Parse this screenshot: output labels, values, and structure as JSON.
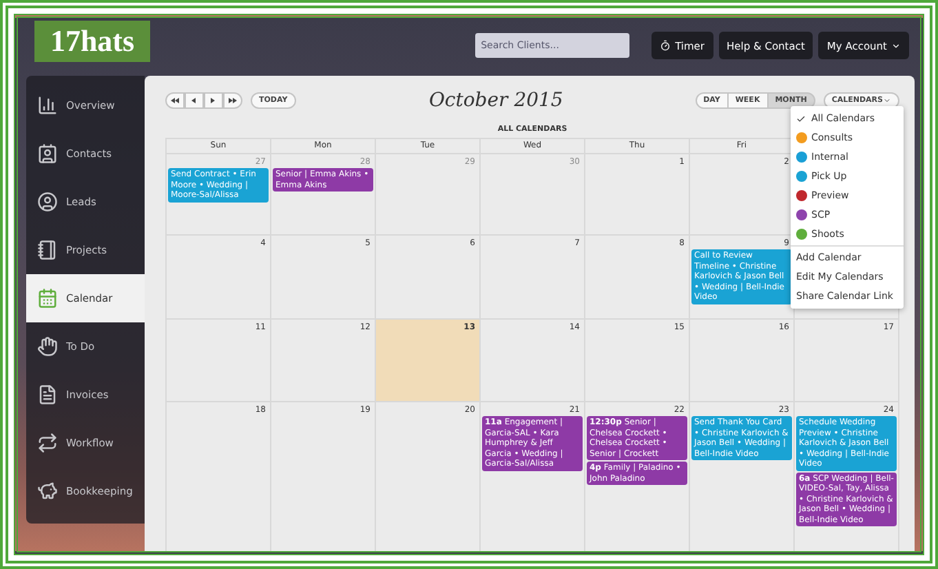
{
  "logo": "17hats",
  "header": {
    "search": {
      "placeholder": "Search Clients..."
    },
    "timer": "Timer",
    "help": "Help & Contact",
    "account": "My Account"
  },
  "sidebar": {
    "items": [
      {
        "label": "Overview",
        "selected": false
      },
      {
        "label": "Contacts",
        "selected": false
      },
      {
        "label": "Leads",
        "selected": false
      },
      {
        "label": "Projects",
        "selected": false
      },
      {
        "label": "Calendar",
        "selected": true
      },
      {
        "label": "To Do",
        "selected": false
      },
      {
        "label": "Invoices",
        "selected": false
      },
      {
        "label": "Workflow",
        "selected": false
      },
      {
        "label": "Bookkeeping",
        "selected": false
      }
    ]
  },
  "toolbar": {
    "today": "TODAY",
    "title": "October 2015",
    "views": [
      {
        "label": "DAY",
        "selected": false
      },
      {
        "label": "WEEK",
        "selected": false
      },
      {
        "label": "MONTH",
        "selected": true
      }
    ],
    "calendars_button": "CALENDARS"
  },
  "subtitle": "ALL CALENDARS",
  "weekdays": [
    "Sun",
    "Mon",
    "Tue",
    "Wed",
    "Thu",
    "Fri"
  ],
  "weeks": [
    {
      "days": [
        {
          "date": "27",
          "muted": true,
          "events": [
            {
              "text": "Send Contract • Erin Moore • Wedding | Moore-Sal/Alissa",
              "color": "#1aa3d4"
            }
          ]
        },
        {
          "date": "28",
          "muted": true,
          "events": [
            {
              "text": "Senior | Emma Akins • Emma Akins",
              "color": "#8e3aa6"
            }
          ]
        },
        {
          "date": "29",
          "muted": true
        },
        {
          "date": "30",
          "muted": true
        },
        {
          "date": "1",
          "muted": false
        },
        {
          "date": "2",
          "muted": false
        }
      ]
    },
    {
      "days": [
        {
          "date": "4"
        },
        {
          "date": "5"
        },
        {
          "date": "6"
        },
        {
          "date": "7"
        },
        {
          "date": "8"
        },
        {
          "date": "9",
          "events": [
            {
              "text": "Call to Review Timeline • Christine Karlovich & Jason Bell • Wedding | Bell-Indie Video",
              "color": "#1aa3d4"
            }
          ]
        }
      ]
    },
    {
      "days": [
        {
          "date": "11"
        },
        {
          "date": "12"
        },
        {
          "date": "13",
          "today": true
        },
        {
          "date": "14"
        },
        {
          "date": "15"
        },
        {
          "date": "16"
        },
        {
          "date": "17"
        }
      ]
    },
    {
      "days": [
        {
          "date": "18"
        },
        {
          "date": "19"
        },
        {
          "date": "20"
        },
        {
          "date": "21",
          "events": [
            {
              "text": "**11a** Engagement | Garcia-SAL • Kara Humphrey & Jeff Garcia • Wedding | Garcia-Sal/Alissa",
              "color": "#8e3aa6"
            }
          ]
        },
        {
          "date": "22",
          "events": [
            {
              "text": "**12:30p** Senior | Chelsea Crockett • Chelsea Crockett • Senior | Crockett",
              "color": "#8e3aa6"
            },
            {
              "text": "**4p** Family | Paladino • John Paladino",
              "color": "#8e3aa6"
            }
          ]
        },
        {
          "date": "23",
          "events": [
            {
              "text": "Send Thank You Card • Christine Karlovich & Jason Bell • Wedding | Bell-Indie Video",
              "color": "#1aa3d4"
            }
          ]
        },
        {
          "date": "24",
          "events": [
            {
              "text": "Schedule Wedding Preview • Christine Karlovich & Jason Bell • Wedding | Bell-Indie Video",
              "color": "#1aa3d4"
            },
            {
              "text": "**6a** SCP Wedding | Bell-VIDEO-Sal, Tay, Alissa • Christine Karlovich & Jason Bell • Wedding | Bell-Indie Video",
              "color": "#8e3aa6"
            }
          ]
        }
      ]
    }
  ],
  "calendars_menu": {
    "all_label": "All Calendars",
    "all_checked": true,
    "calendars": [
      {
        "label": "Consults",
        "color": "#f39c1f"
      },
      {
        "label": "Internal",
        "color": "#1a9fd6"
      },
      {
        "label": "Pick Up",
        "color": "#1aa3d4"
      },
      {
        "label": "Preview",
        "color": "#c0282d"
      },
      {
        "label": "SCP",
        "color": "#8e44ad"
      },
      {
        "label": "Shoots",
        "color": "#5fae3c"
      }
    ],
    "actions": [
      "Add Calendar",
      "Edit My Calendars",
      "Share Calendar Link"
    ]
  }
}
